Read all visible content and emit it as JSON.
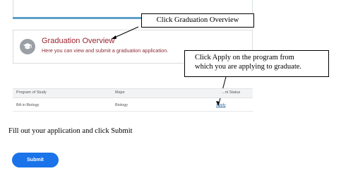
{
  "graduation_card": {
    "title": "Graduation Overview",
    "description": "Here you can view and submit a graduation application."
  },
  "callouts": {
    "click_overview": "Click Graduation Overview",
    "apply_line1": "Click Apply on the program from",
    "apply_line2": "which you are applying to graduate."
  },
  "table": {
    "headers": [
      "Program of Study",
      "Major",
      "...nt Status"
    ],
    "rows": [
      {
        "program": "BA in Biology",
        "major": "Biology",
        "action": "Apply"
      }
    ]
  },
  "instruction": "Fill out your application and click Submit",
  "submit_label": "Submit",
  "colors": {
    "accent": "#5d9fc8",
    "title": "#9a2430",
    "button": "#1a73e8"
  },
  "icons": {
    "graduation": "graduation-cap-icon"
  }
}
